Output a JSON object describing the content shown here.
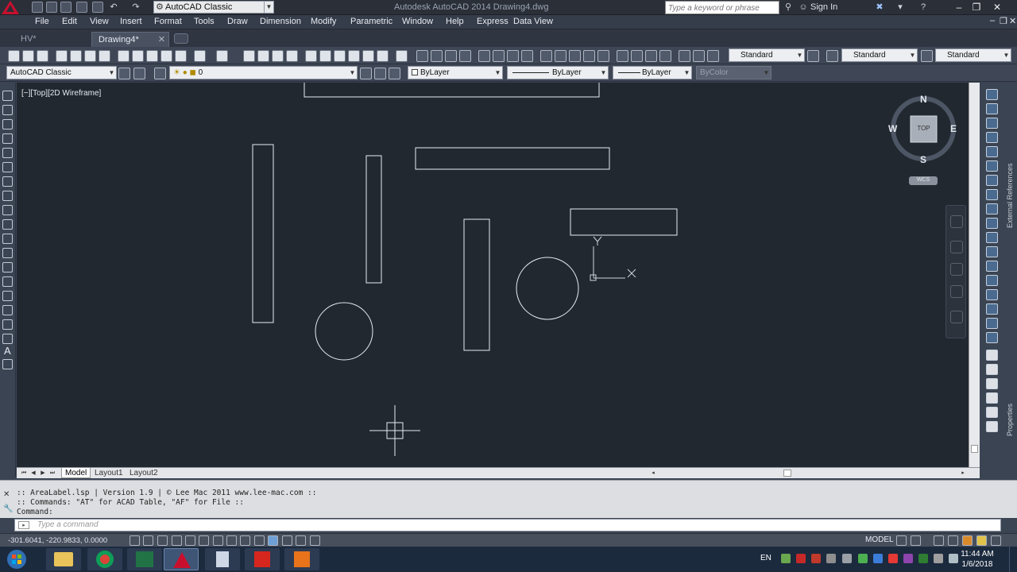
{
  "window": {
    "title": "Autodesk AutoCAD 2014    Drawing4.dwg",
    "workspace": "AutoCAD Classic",
    "search_placeholder": "Type a keyword or phrase",
    "sign_in": "Sign In"
  },
  "menu": [
    "File",
    "Edit",
    "View",
    "Insert",
    "Format",
    "Tools",
    "Draw",
    "Dimension",
    "Modify",
    "Parametric",
    "Window",
    "Help",
    "Express",
    "Data View"
  ],
  "file_tabs": [
    {
      "label": "HV*"
    },
    {
      "label": "Drawing4*",
      "close": "✕"
    }
  ],
  "toolbar": {
    "text_style": "Standard",
    "dim_style": "Standard",
    "table_style": "Standard",
    "multileader_style": "Standard",
    "workspace_combo": "AutoCAD Classic",
    "layer": "0",
    "color": "ByLayer",
    "linetype": "ByLayer",
    "lineweight": "ByLayer",
    "plotstyle": "ByColor"
  },
  "viewport": {
    "label": "[−][Top][2D Wireframe]",
    "viewcube": {
      "n": "N",
      "s": "S",
      "e": "E",
      "w": "W",
      "face": "TOP",
      "wcs": "WCS"
    }
  },
  "right_panels": {
    "external_references": "External References",
    "properties": "Properties"
  },
  "layout_tabs": [
    "Model",
    "Layout1",
    "Layout2"
  ],
  "command": {
    "history": [
      ":: AreaLabel.lsp | Version 1.9 | © Lee Mac 2011 www.lee-mac.com ::",
      ":: Commands: \"AT\" for ACAD Table, \"AF\" for File ::",
      "Command:"
    ],
    "placeholder": "Type a command"
  },
  "status": {
    "coordinates": "-301.6041, -220.9833, 0.0000",
    "model": "MODEL"
  },
  "taskbar": {
    "language": "EN",
    "time": "11:44 AM",
    "date": "1/6/2018"
  }
}
